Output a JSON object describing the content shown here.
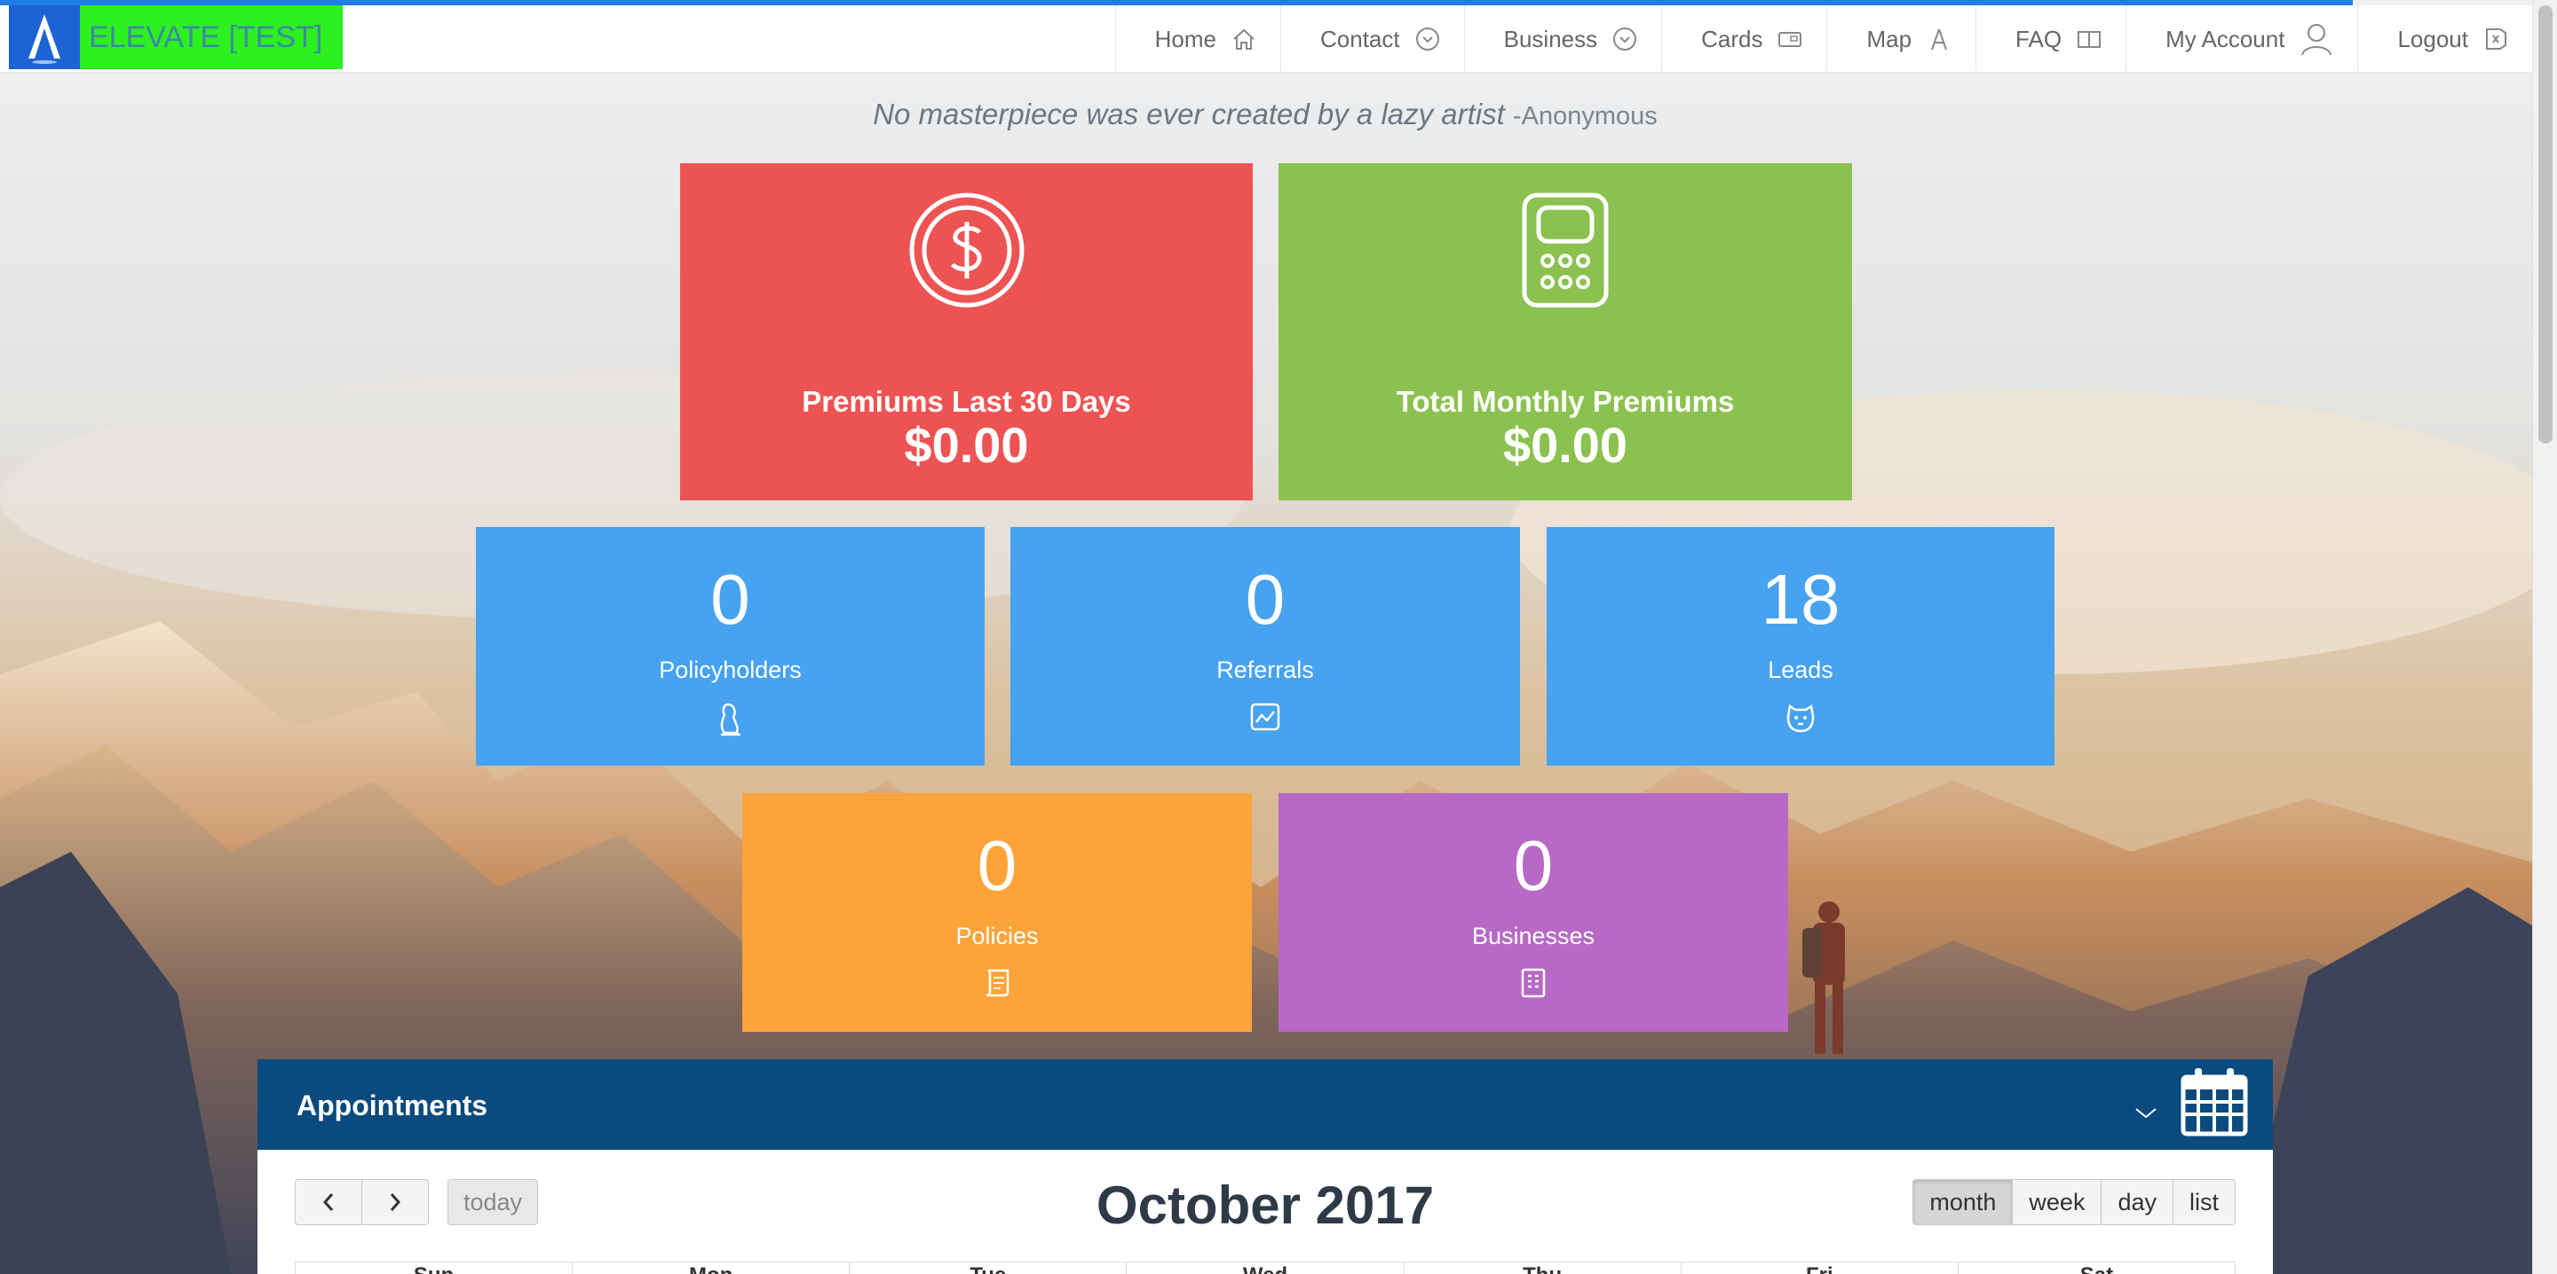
{
  "navbar": {
    "brand": "ELEVATE [TEST]",
    "items": [
      {
        "label": "Home",
        "icon": "home-icon"
      },
      {
        "label": "Contact",
        "icon": "chevron-circle-icon"
      },
      {
        "label": "Business",
        "icon": "chevron-circle-icon"
      },
      {
        "label": "Cards",
        "icon": "card-icon"
      },
      {
        "label": "Map",
        "icon": "compass-icon"
      },
      {
        "label": "FAQ",
        "icon": "book-icon"
      },
      {
        "label": "My Account",
        "icon": "user-icon"
      },
      {
        "label": "Logout",
        "icon": "logout-icon"
      }
    ]
  },
  "quote": {
    "text": "No masterpiece was ever created by a lazy artist",
    "author": "-Anonymous"
  },
  "tiles": {
    "premiums_30": {
      "label": "Premiums Last 30 Days",
      "amount": "$0.00",
      "color": "#ee5353"
    },
    "monthly_premiums": {
      "label": "Total Monthly Premiums",
      "amount": "$0.00",
      "color": "#8bc24f"
    },
    "policyholders": {
      "count": "0",
      "label": "Policyholders",
      "color": "#47a2ef"
    },
    "referrals": {
      "count": "0",
      "label": "Referrals",
      "color": "#47a2ef"
    },
    "leads": {
      "count": "18",
      "label": "Leads",
      "color": "#47a2ef"
    },
    "policies": {
      "count": "0",
      "label": "Policies",
      "color": "#fca43a"
    },
    "businesses": {
      "count": "0",
      "label": "Businesses",
      "color": "#b769c5"
    }
  },
  "appointments": {
    "title": "Appointments",
    "calendar": {
      "title": "October 2017",
      "today_label": "today",
      "views": [
        "month",
        "week",
        "day",
        "list"
      ],
      "active_view": "month",
      "weekdays": [
        "Sun",
        "Mon",
        "Tue",
        "Wed",
        "Thu",
        "Fri",
        "Sat"
      ]
    }
  }
}
